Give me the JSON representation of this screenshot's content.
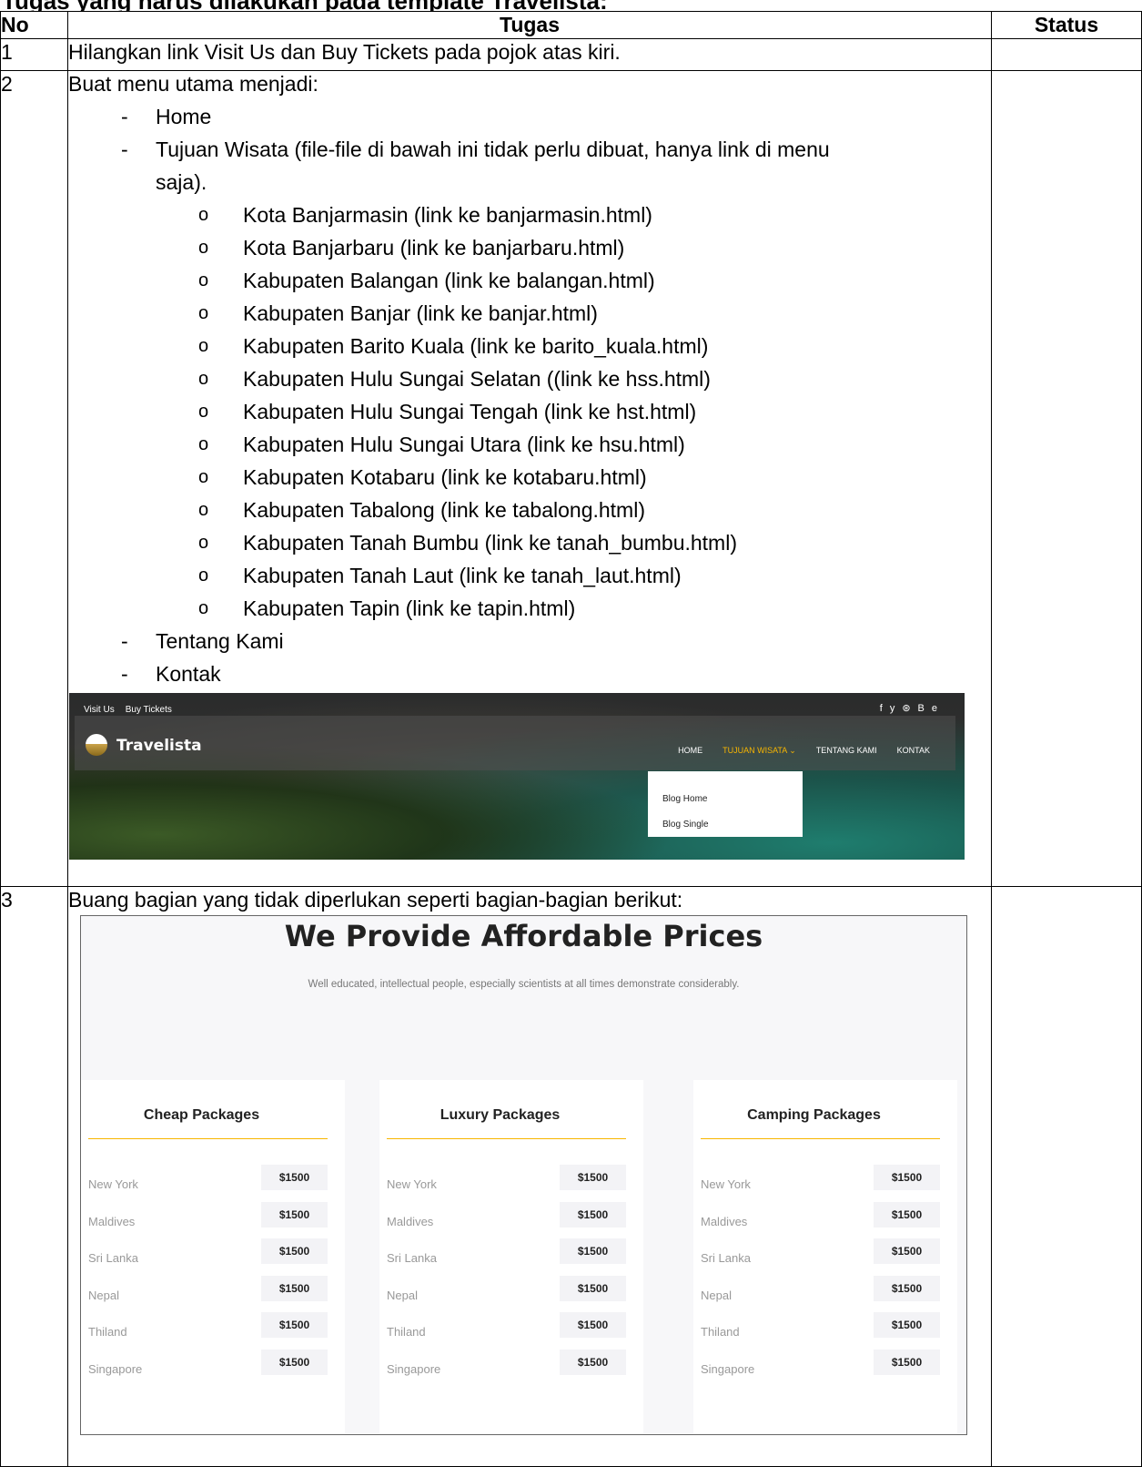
{
  "top_heading_fragment": "Tugas yang harus dilakukan pada template Travelista:",
  "table": {
    "headers": {
      "no": "No",
      "tugas": "Tugas",
      "status": "Status"
    },
    "rows": [
      {
        "no": "1",
        "text": "Hilangkan link Visit Us dan Buy Tickets pada pojok atas kiri."
      },
      {
        "no": "2",
        "text": "Buat menu utama menjadi:"
      },
      {
        "no": "3",
        "text": "Buang bagian yang tidak diperlukan seperti bagian-bagian berikut:"
      }
    ]
  },
  "menu_list": {
    "dash": "-",
    "bullet": "o",
    "home": "Home",
    "tujuan_line1": "Tujuan Wisata (file-file di bawah ini tidak perlu dibuat, hanya link di menu",
    "tujuan_line2": "saja).",
    "sub": [
      "Kota Banjarmasin (link ke banjarmasin.html)",
      "Kota Banjarbaru (link ke banjarbaru.html)",
      "Kabupaten Balangan (link ke balangan.html)",
      "Kabupaten Banjar (link ke banjar.html)",
      "Kabupaten Barito Kuala (link ke barito_kuala.html)",
      "Kabupaten Hulu Sungai Selatan ((link ke hss.html)",
      "Kabupaten Hulu Sungai Tengah (link ke hst.html)",
      "Kabupaten Hulu Sungai Utara (link ke hsu.html)",
      "Kabupaten Kotabaru (link ke kotabaru.html)",
      "Kabupaten Tabalong (link ke tabalong.html)",
      "Kabupaten Tanah Bumbu (link ke tanah_bumbu.html)",
      "Kabupaten Tanah Laut (link ke tanah_laut.html)",
      "Kabupaten Tapin (link ke tapin.html)"
    ],
    "tentang": "Tentang Kami",
    "kontak": "Kontak"
  },
  "travelista": {
    "topbar_links": [
      "Visit Us",
      "Buy Tickets"
    ],
    "social_icons": [
      "facebook-icon",
      "twitter-icon",
      "dribbble-icon",
      "behance-icon"
    ],
    "social_glyphs": [
      "f",
      "y",
      "⊛",
      "Be"
    ],
    "brand": "Travelista",
    "menu": [
      "HOME",
      "TUJUAN WISATA ⌄",
      "TENTANG KAMI",
      "KONTAK"
    ],
    "dropdown": [
      "Blog Home",
      "Blog Single"
    ],
    "accent": "#f8b600"
  },
  "prices": {
    "title": "We Provide Affordable Prices",
    "subtitle": "Well educated, intellectual people, especially scientists at all times demonstrate considerably.",
    "columns": [
      {
        "heading": "Cheap Packages",
        "items": [
          [
            "New York",
            "$1500"
          ],
          [
            "Maldives",
            "$1500"
          ],
          [
            "Sri Lanka",
            "$1500"
          ],
          [
            "Nepal",
            "$1500"
          ],
          [
            "Thiland",
            "$1500"
          ],
          [
            "Singapore",
            "$1500"
          ]
        ]
      },
      {
        "heading": "Luxury Packages",
        "items": [
          [
            "New York",
            "$1500"
          ],
          [
            "Maldives",
            "$1500"
          ],
          [
            "Sri Lanka",
            "$1500"
          ],
          [
            "Nepal",
            "$1500"
          ],
          [
            "Thiland",
            "$1500"
          ],
          [
            "Singapore",
            "$1500"
          ]
        ]
      },
      {
        "heading": "Camping Packages",
        "items": [
          [
            "New York",
            "$1500"
          ],
          [
            "Maldives",
            "$1500"
          ],
          [
            "Sri Lanka",
            "$1500"
          ],
          [
            "Nepal",
            "$1500"
          ],
          [
            "Thiland",
            "$1500"
          ],
          [
            "Singapore",
            "$1500"
          ]
        ]
      }
    ]
  }
}
